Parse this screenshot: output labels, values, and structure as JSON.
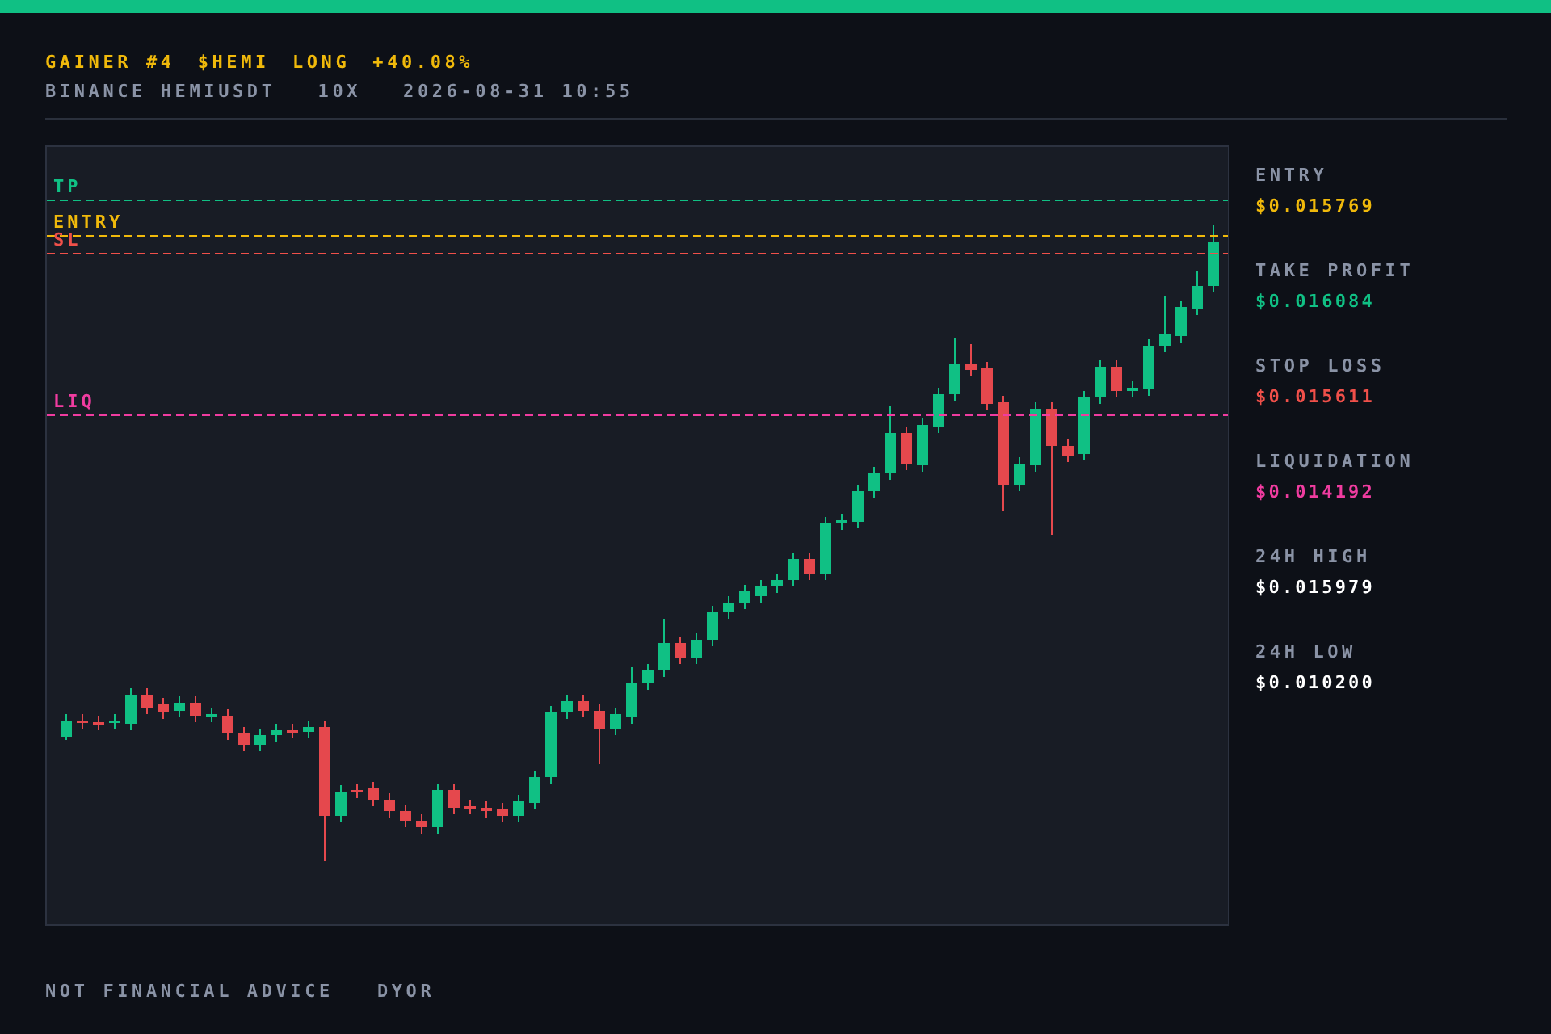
{
  "header": {
    "title_parts": [
      "GAINER #4",
      "$HEMI",
      "LONG",
      "+40.08%"
    ],
    "subtitle_parts": [
      "BINANCE HEMIUSDT",
      "10X",
      "2026-08-31 10:55"
    ]
  },
  "chart": {
    "price_lines": [
      {
        "label": "TP",
        "color": "#10c084"
      },
      {
        "label": "ENTRY",
        "color": "#f0b90b"
      },
      {
        "label": "SL",
        "color": "#f0504a"
      },
      {
        "label": "LIQ",
        "color": "#f03ca0"
      }
    ]
  },
  "stats": [
    {
      "label": "ENTRY",
      "value": "$0.015769",
      "color": "#f0b90b"
    },
    {
      "label": "TAKE PROFIT",
      "value": "$0.016084",
      "color": "#10c084"
    },
    {
      "label": "STOP LOSS",
      "value": "$0.015611",
      "color": "#f0504a"
    },
    {
      "label": "LIQUIDATION",
      "value": "$0.014192",
      "color": "#f03ca0"
    },
    {
      "label": "24H HIGH",
      "value": "$0.015979",
      "color": "#ffffff"
    },
    {
      "label": "24H LOW",
      "value": "$0.010200",
      "color": "#ffffff"
    }
  ],
  "footer": {
    "parts": [
      "NOT FINANCIAL ADVICE",
      "DYOR"
    ]
  }
}
